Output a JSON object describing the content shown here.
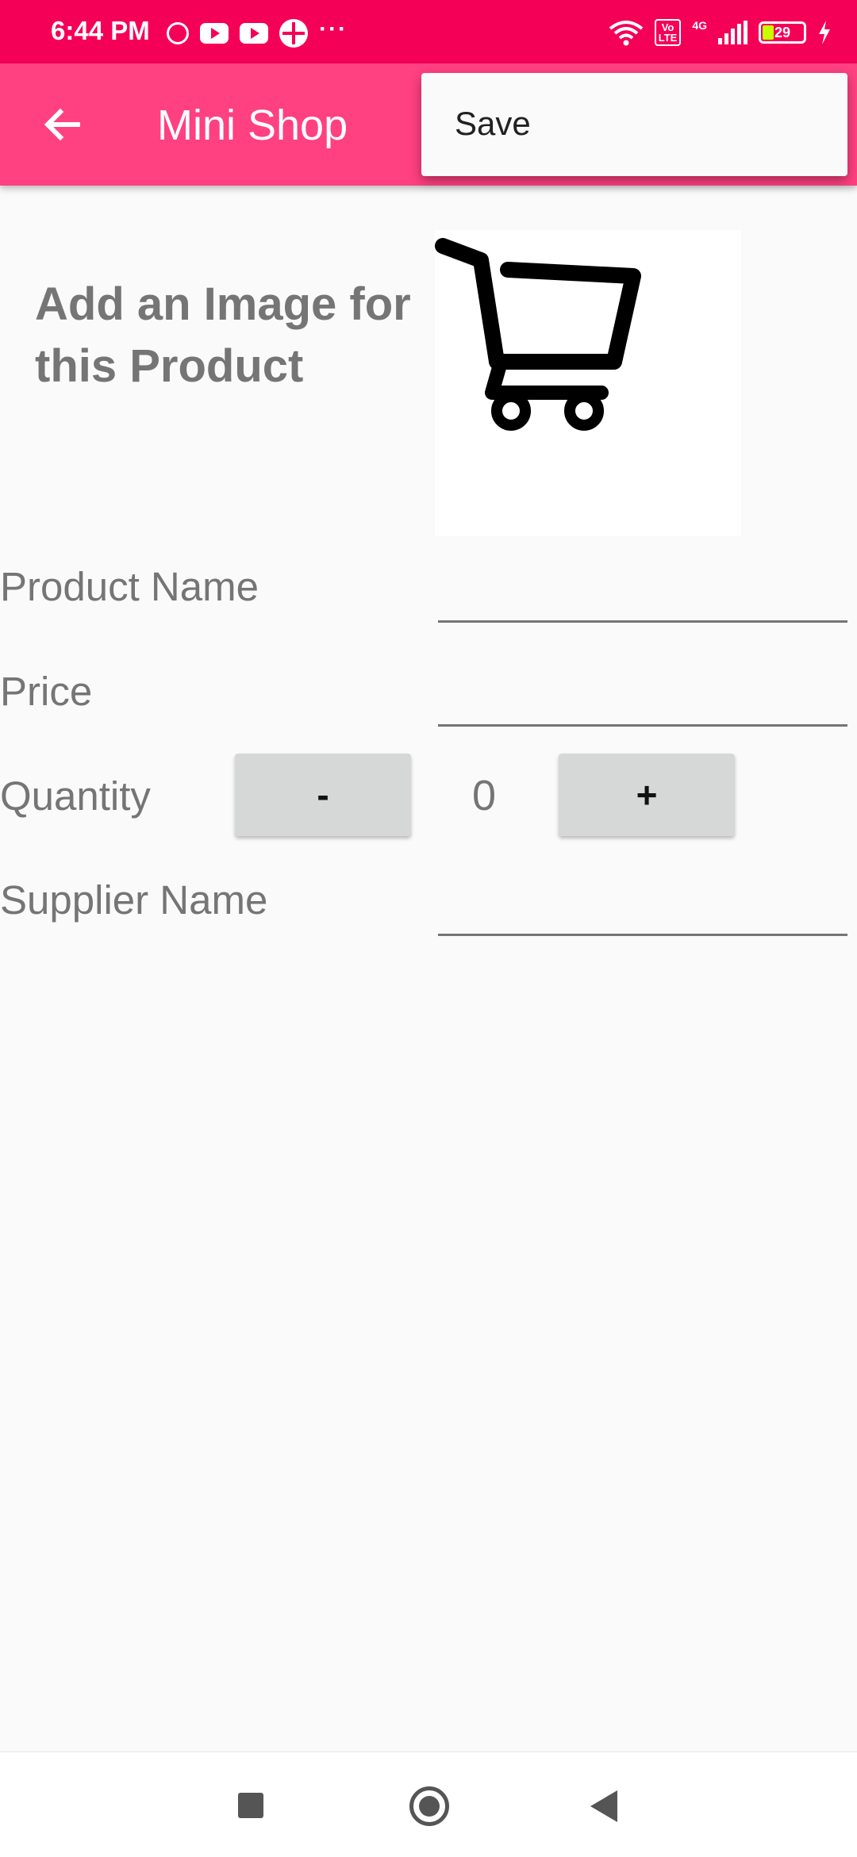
{
  "status_bar": {
    "time": "6:44 PM",
    "volte": "Vo\nLTE",
    "network": "4G",
    "battery": "29",
    "icons_left": [
      "alarm-icon",
      "youtube-icon",
      "youtube-icon",
      "app-icon",
      "more-dots-icon"
    ],
    "icons_right": [
      "wifi-icon",
      "volte-icon",
      "signal-icon",
      "battery-icon",
      "charging-icon"
    ],
    "dots": "···"
  },
  "app_bar": {
    "title": "Mini Shop",
    "back_icon": "arrow-back-icon"
  },
  "overflow_menu": {
    "items": [
      {
        "label": "Save"
      }
    ]
  },
  "image_section": {
    "prompt": "Add an Image for this Product",
    "image_icon": "shopping-cart-icon"
  },
  "form": {
    "product_name_label": "Product Name",
    "product_name_value": "",
    "price_label": "Price",
    "price_value": "",
    "quantity_label": "Quantity",
    "decrement_label": "-",
    "quantity_value": "0",
    "increment_label": "+",
    "supplier_name_label": "Supplier Name",
    "supplier_name_value": ""
  },
  "colors": {
    "status_bar": "#f50057",
    "app_bar": "#ff4081",
    "label_text": "#757575",
    "button_bg": "#d6d7d7"
  },
  "nav_bar": {
    "icons": [
      "recents-square-icon",
      "home-circle-icon",
      "back-triangle-icon"
    ]
  }
}
